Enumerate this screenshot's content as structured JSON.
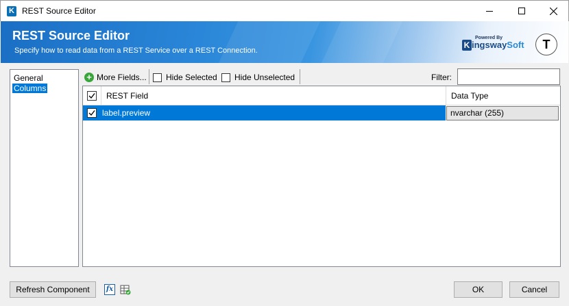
{
  "window": {
    "title": "REST Source Editor",
    "app_icon_letter": "K"
  },
  "banner": {
    "title": "REST Source Editor",
    "subtitle": "Specify how to read data from a REST Service over a REST Connection.",
    "powered_by": "Powered By",
    "brand_initial": "K",
    "brand_name": "ingsway",
    "brand_suffix": "Soft",
    "avatar_letter": "T"
  },
  "nav": {
    "items": [
      {
        "label": "General",
        "selected": false
      },
      {
        "label": "Columns",
        "selected": true
      }
    ]
  },
  "toolbar": {
    "more_fields_label": "More Fields...",
    "hide_selected_label": "Hide Selected",
    "hide_unselected_label": "Hide Unselected",
    "filter_label": "Filter:",
    "filter_value": ""
  },
  "grid": {
    "columns": [
      "REST Field",
      "Data Type"
    ],
    "header_checked": true,
    "rows": [
      {
        "checked": true,
        "field": "label.preview",
        "data_type": "nvarchar (255)",
        "selected": true
      }
    ]
  },
  "footer": {
    "refresh_label": "Refresh Component",
    "fx_label": "fx",
    "ok_label": "OK",
    "cancel_label": "Cancel"
  },
  "colors": {
    "selection": "#0078d7",
    "banner_start": "#1a6fc4",
    "add_icon": "#3aa53a"
  }
}
